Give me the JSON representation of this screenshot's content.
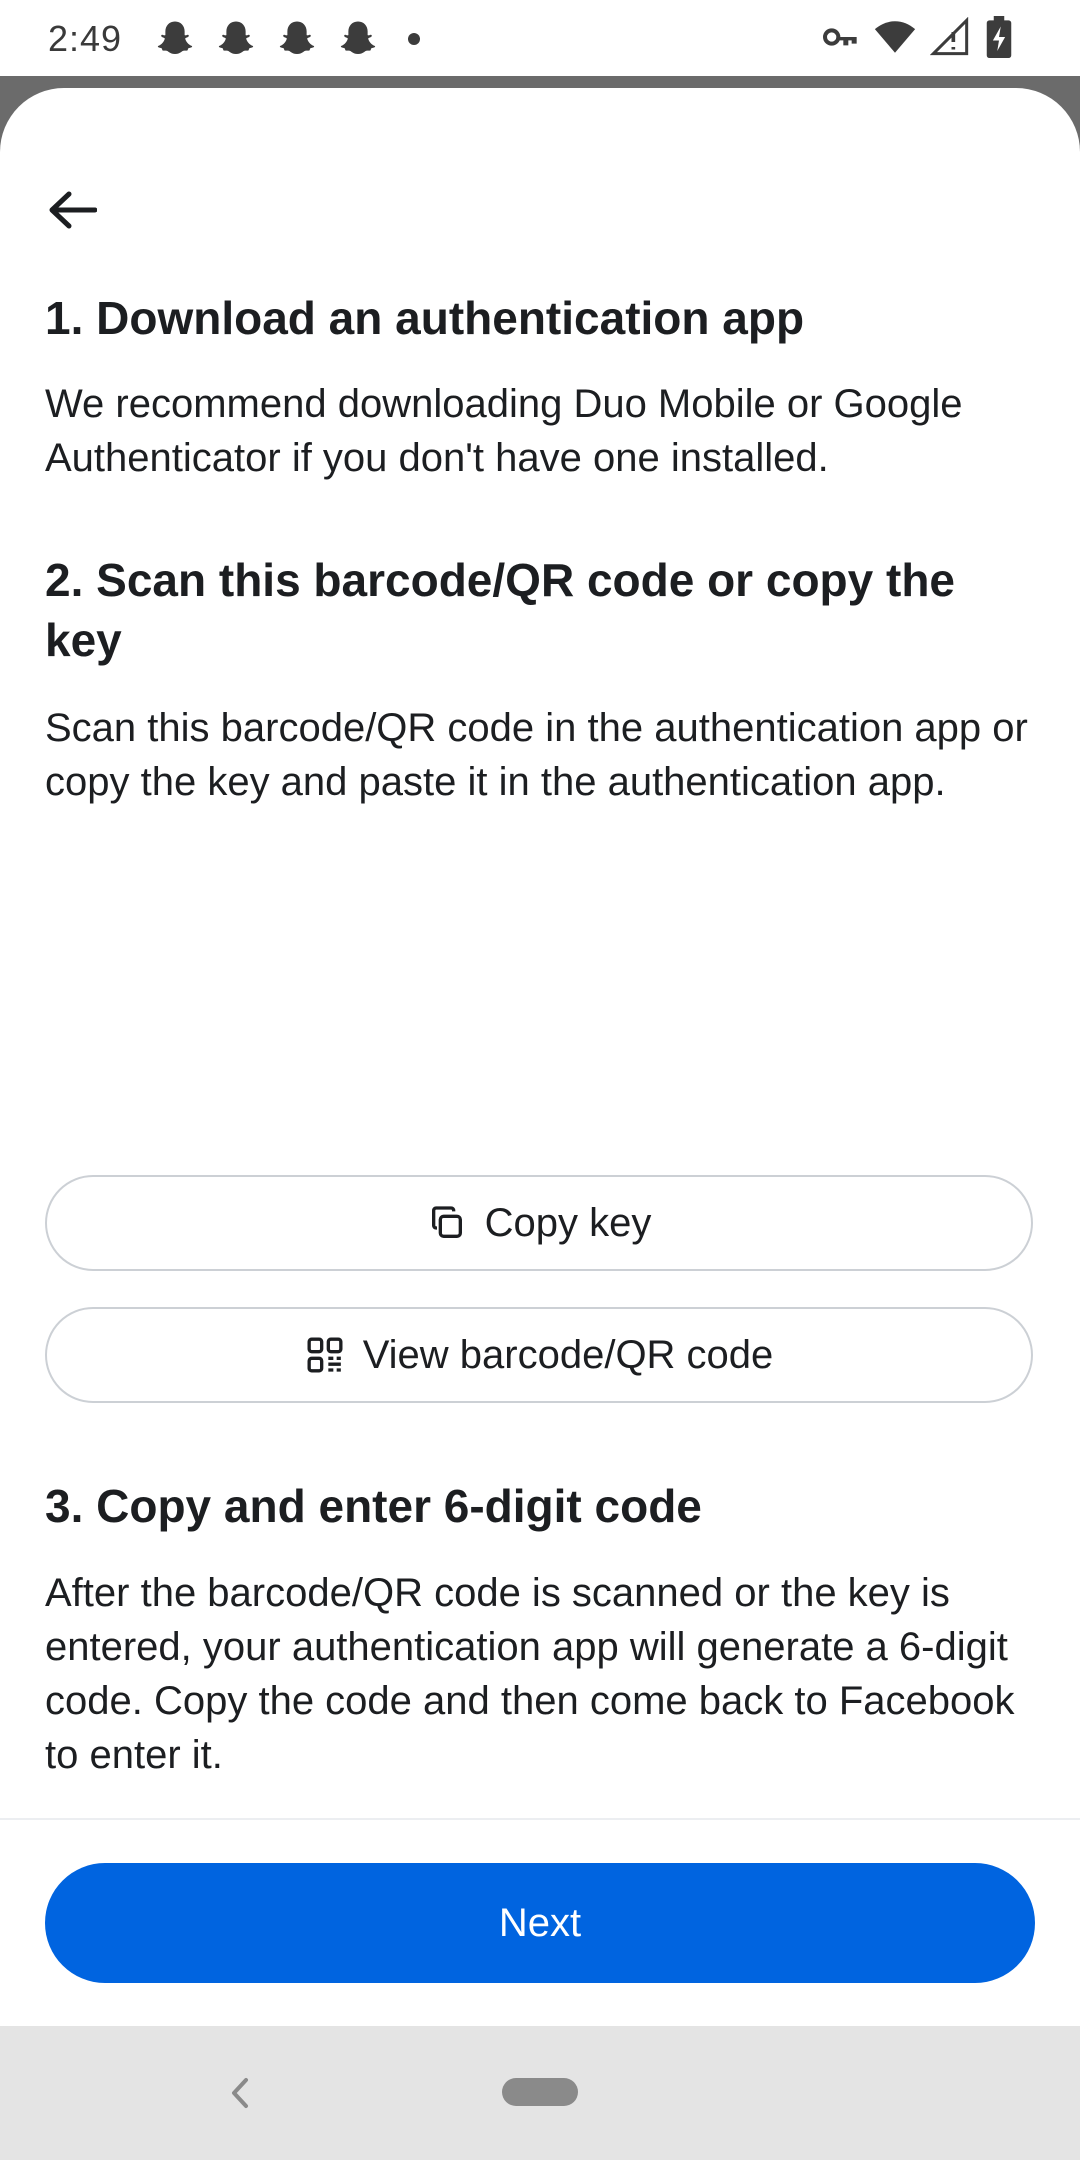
{
  "status_bar": {
    "time": "2:49",
    "notification_icons": [
      "snapchat-icon",
      "snapchat-icon",
      "snapchat-icon",
      "snapchat-icon"
    ],
    "system_icons": [
      "vpn-key-icon",
      "wifi-icon",
      "signal-icon",
      "battery-charging-icon"
    ]
  },
  "steps": [
    {
      "heading": "1. Download an authentication app",
      "body": "We recommend downloading Duo Mobile or Google Authenticator if you don't have one installed."
    },
    {
      "heading": "2. Scan this barcode/QR code or copy the key",
      "body": "Scan this barcode/QR code in the authentication app or copy the key and paste it in the authentication app."
    },
    {
      "heading": "3. Copy and enter 6-digit code",
      "body": "After the barcode/QR code is scanned or the key is entered, your authentication app will generate a 6-digit code. Copy the code and then come back to Facebook to enter it."
    }
  ],
  "buttons": {
    "copy_key": "Copy key",
    "view_qr": "View barcode/QR code",
    "next": "Next"
  },
  "colors": {
    "primary": "#0064e0",
    "text": "#1c1e21",
    "button_border": "#ccd0d5"
  }
}
